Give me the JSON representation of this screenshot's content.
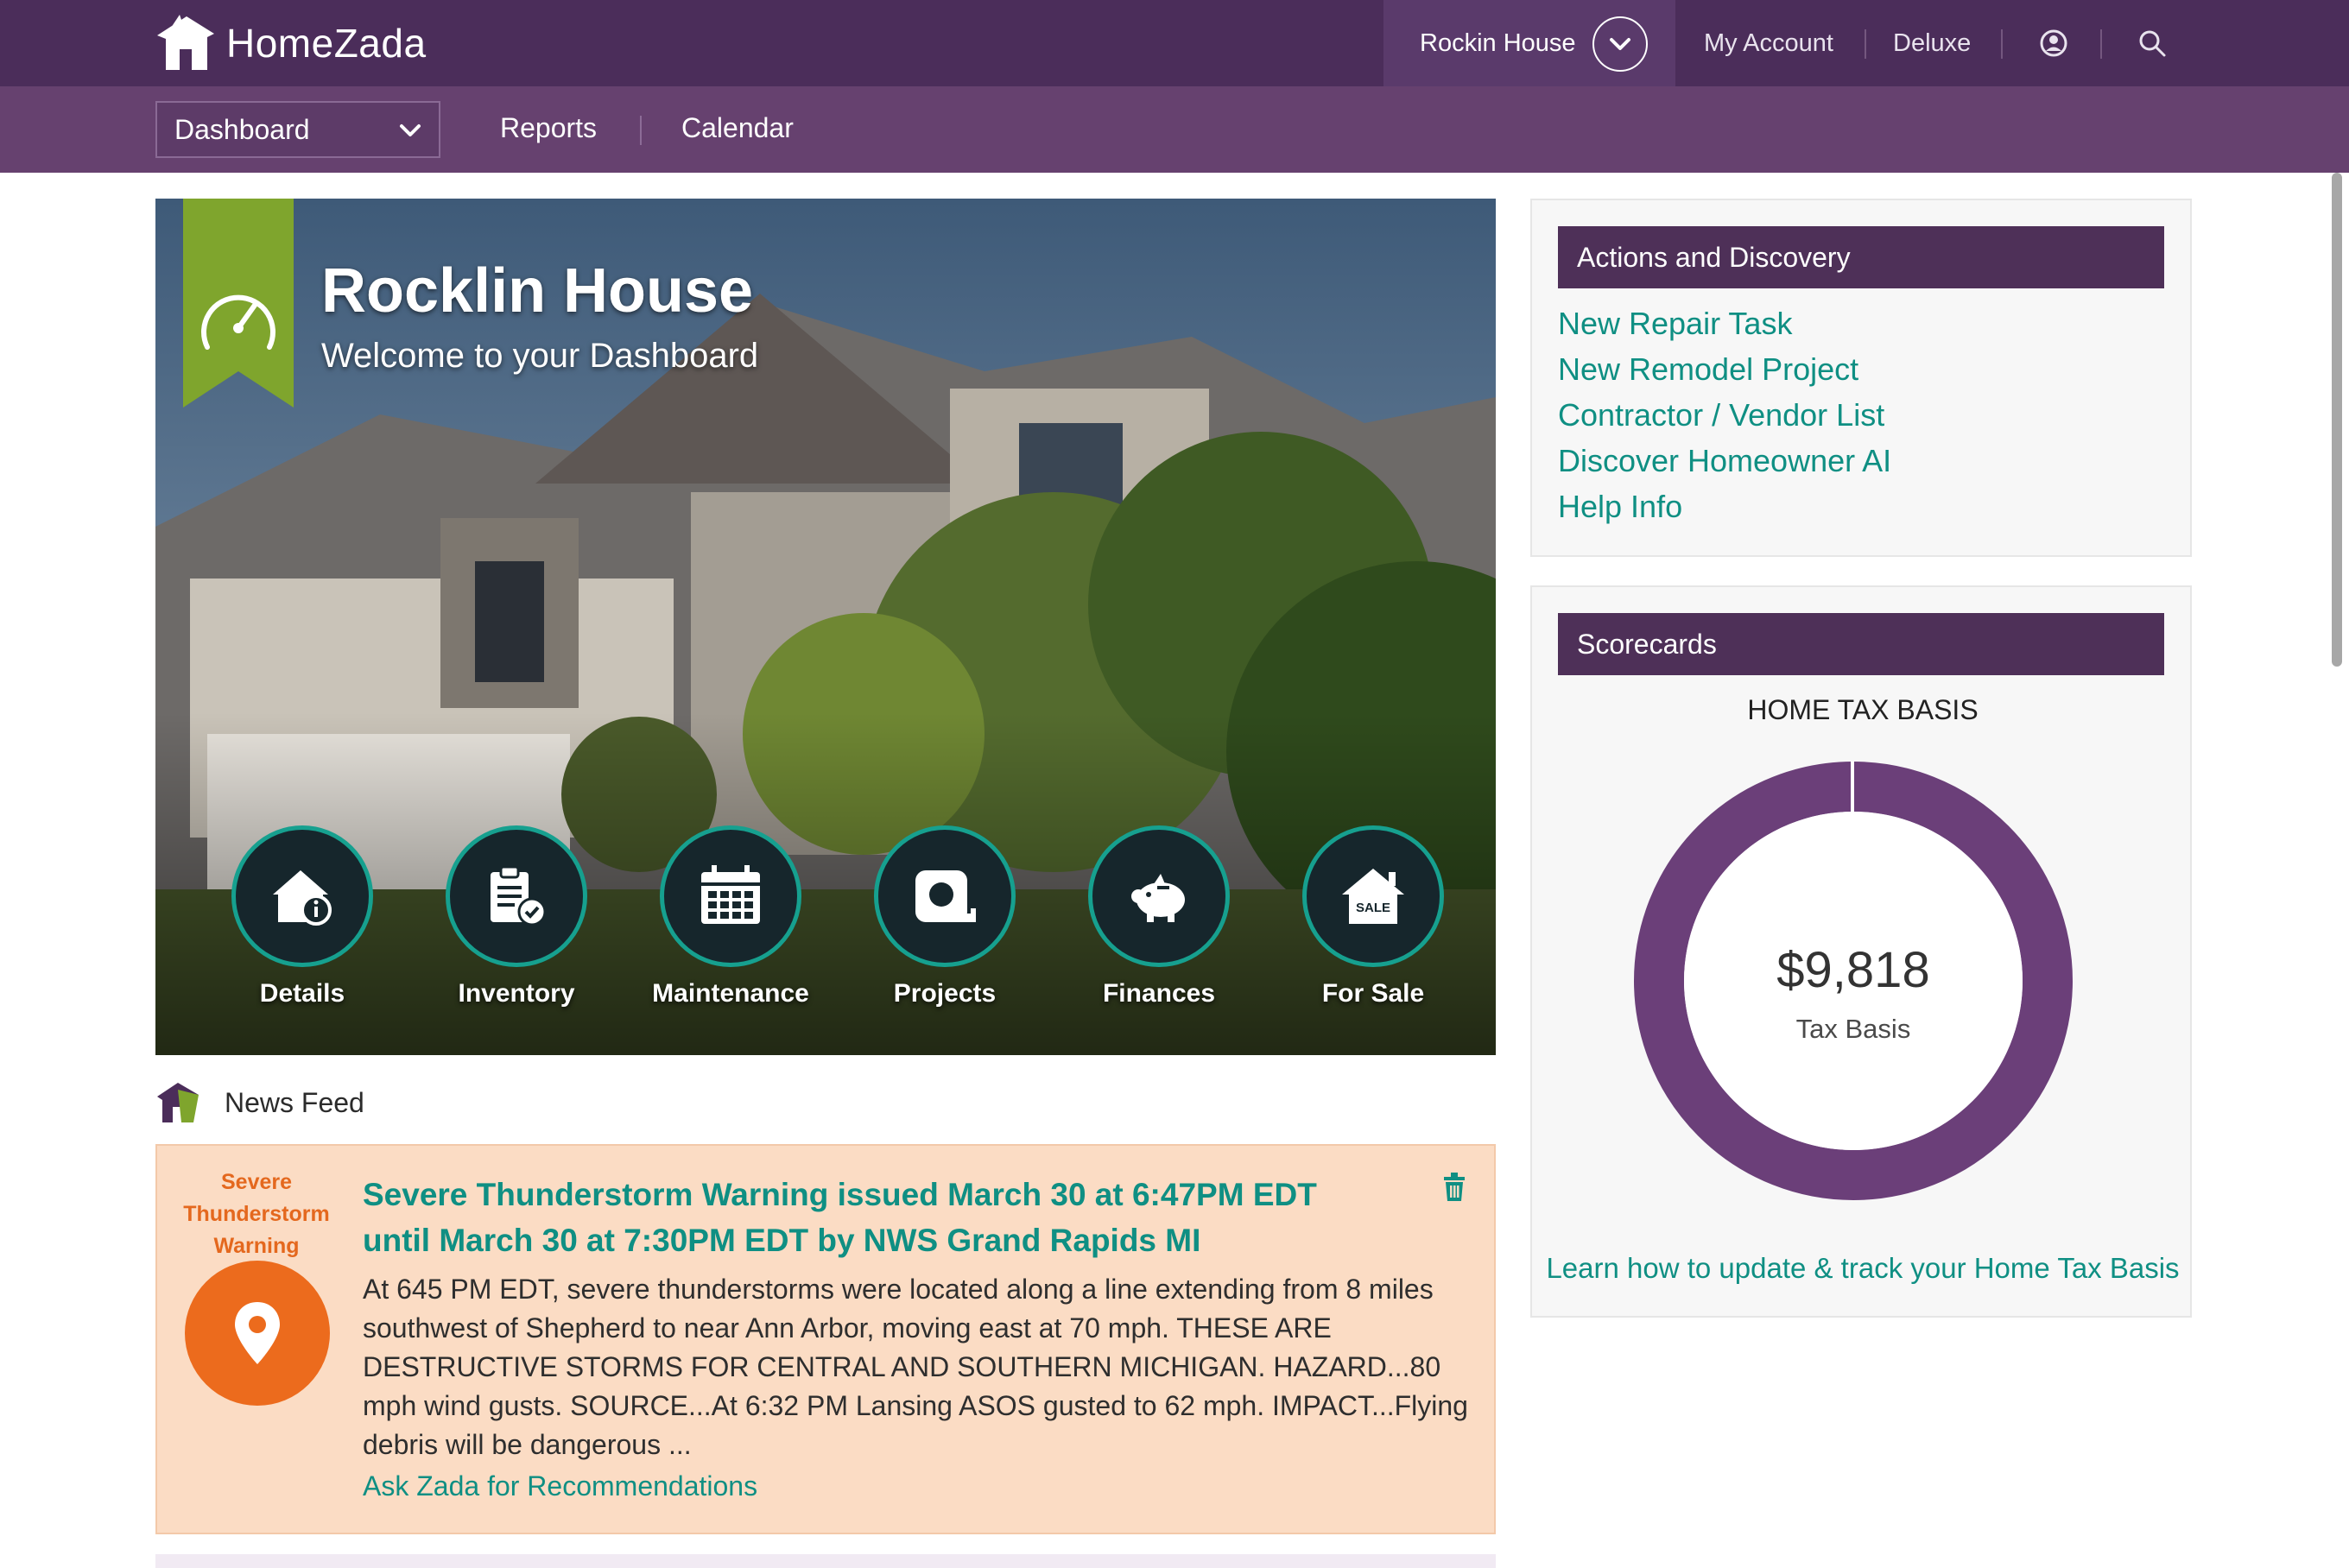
{
  "header": {
    "brand": "HomeZada",
    "house_selector": "Rockin House",
    "my_account": "My Account",
    "plan": "Deluxe"
  },
  "subnav": {
    "dashboard_select": "Dashboard",
    "reports": "Reports",
    "calendar": "Calendar"
  },
  "hero": {
    "title": "Rocklin House",
    "subtitle": "Welcome to your Dashboard",
    "tiles": [
      {
        "label": "Details",
        "icon": "house-info-icon"
      },
      {
        "label": "Inventory",
        "icon": "clipboard-check-icon"
      },
      {
        "label": "Maintenance",
        "icon": "calendar-icon"
      },
      {
        "label": "Projects",
        "icon": "tape-measure-icon"
      },
      {
        "label": "Finances",
        "icon": "piggy-bank-icon"
      },
      {
        "label": "For Sale",
        "icon": "house-sale-icon",
        "badge": "SALE"
      }
    ]
  },
  "news": {
    "heading": "News Feed",
    "item": {
      "type": "Severe Thunderstorm Warning",
      "title": "Severe Thunderstorm Warning issued March 30 at 6:47PM EDT until March 30 at 7:30PM EDT by NWS Grand Rapids MI",
      "body": "At 645 PM EDT, severe thunderstorms were located along a line extending from 8 miles southwest of Shepherd to near Ann Arbor, moving east at 70 mph. THESE ARE DESTRUCTIVE STORMS FOR CENTRAL AND SOUTHERN MICHIGAN. HAZARD...80 mph wind gusts. SOURCE...At 6:32 PM Lansing ASOS gusted to 62 mph. IMPACT...Flying debris will be dangerous ...",
      "link": "Ask Zada for Recommendations"
    }
  },
  "actions": {
    "heading": "Actions and Discovery",
    "links": [
      "New Repair Task",
      "New Remodel Project",
      "Contractor / Vendor List",
      "Discover Homeowner AI",
      "Help Info"
    ]
  },
  "scorecards": {
    "heading": "Scorecards",
    "title": "HOME TAX BASIS",
    "value": "$9,818",
    "value_label": "Tax Basis",
    "link": "Learn how to update & track your Home Tax Basis"
  },
  "colors": {
    "topbar": "#4b2d5a",
    "subbar": "#66416f",
    "accent_teal": "#0f8f83",
    "ribbon_green": "#7fa52d",
    "alert_orange": "#ec6b1d",
    "donut_purple": "#6b3f79"
  }
}
